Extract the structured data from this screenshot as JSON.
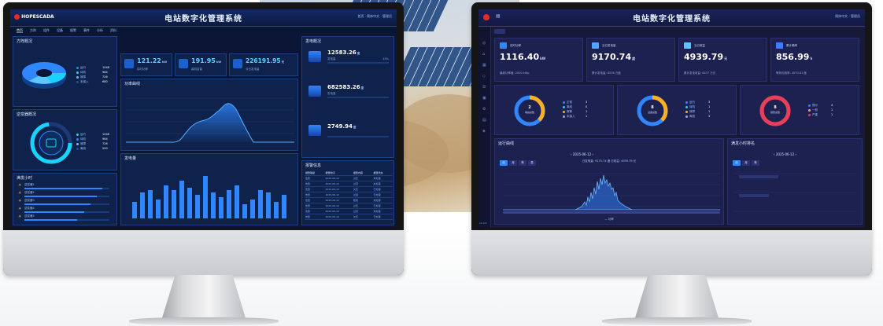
{
  "left_screen": {
    "logo": "HOPESCADA",
    "title": "电站数字化管理系统",
    "header_right": "首页 · 简体中文 · 管理员",
    "nav": [
      "首页",
      "方阵",
      "组件",
      "设备",
      "报警",
      "事件",
      "分析",
      "资料"
    ],
    "panels": {
      "matrix": "方阵概况",
      "inverter": "逆变器概况",
      "hours": "满发小时",
      "power_curve": "功率曲线",
      "energy": "发电量",
      "gen_overview": "发电概况",
      "alarms": "报警信息"
    },
    "kpis": [
      {
        "value": "121.22",
        "unit": "kW",
        "label": "实时功率"
      },
      {
        "value": "191.95",
        "unit": "kW",
        "label": "装机容量"
      },
      {
        "value": "226191.95",
        "unit": "元",
        "label": "今日发电量"
      }
    ],
    "gen_values": [
      {
        "value": "12583.26",
        "unit": "度",
        "label": "发电量",
        "pct": "45%"
      },
      {
        "value": "682583.26",
        "unit": "度",
        "label": "发电量"
      },
      {
        "value": "2749.94",
        "unit": "度",
        "label": ""
      }
    ],
    "matrix_legend": [
      {
        "name": "运行",
        "value": "1048"
      },
      {
        "name": "待机",
        "value": "964"
      },
      {
        "name": "故障",
        "value": "726"
      },
      {
        "name": "未接入",
        "value": "680"
      }
    ],
    "inverter_legend": [
      {
        "name": "运行",
        "value": "1048"
      },
      {
        "name": "待机",
        "value": "964"
      },
      {
        "name": "故障",
        "value": "726"
      },
      {
        "name": "离线",
        "value": "500"
      }
    ],
    "hours_items": [
      "逆变器1",
      "逆变器2",
      "逆变器3",
      "逆变器4",
      "逆变器5"
    ],
    "alarm_headers": [
      "报警等级",
      "报警时间",
      "报警内容",
      "报警状态"
    ],
    "alarm_rows": [
      [
        "告警",
        "2025-06-12",
        "过压",
        "未处理"
      ],
      [
        "告警",
        "2025-06-12",
        "过流",
        "未处理"
      ],
      [
        "告警",
        "2025-06-12",
        "欠压",
        "已处理"
      ],
      [
        "告警",
        "2025-06-12",
        "过温",
        "已处理"
      ],
      [
        "告警",
        "2025-06-12",
        "断线",
        "未处理"
      ],
      [
        "告警",
        "2025-06-12",
        "过压",
        "已处理"
      ],
      [
        "告警",
        "2025-06-12",
        "过流",
        "未处理"
      ],
      [
        "告警",
        "2025-06-12",
        "欠压",
        "已处理"
      ]
    ],
    "energy_bars": [
      0.35,
      0.55,
      0.6,
      0.4,
      0.7,
      0.6,
      0.8,
      0.65,
      0.5,
      0.9,
      0.55,
      0.45,
      0.6,
      0.7,
      0.3,
      0.4,
      0.6,
      0.55,
      0.35,
      0.5
    ]
  },
  "right_screen": {
    "title": "电站数字化管理系统",
    "header_right": "简体中文 · 管理员",
    "kpis": [
      {
        "label": "实时功率",
        "value": "1116.40",
        "unit": "kW",
        "sub": "最新功率值: 2000 kWp"
      },
      {
        "label": "当日发电量",
        "value": "9170.74",
        "unit": "度",
        "sub": "累计发电量: 8536 万度"
      },
      {
        "label": "当日收益",
        "value": "4939.79",
        "unit": "元",
        "sub": "累计发电收益: 8437 万元"
      },
      {
        "label": "累计确率",
        "value": "856.99",
        "unit": "h",
        "sub": "等效利用率: 4070.81 度"
      }
    ],
    "donuts": [
      {
        "center": "2",
        "label": "电站总数",
        "legend": [
          {
            "name": "正常",
            "value": "3"
          },
          {
            "name": "离线",
            "value": "0"
          },
          {
            "name": "报警",
            "value": "1"
          },
          {
            "name": "未接入",
            "value": "1"
          }
        ]
      },
      {
        "center": "8",
        "label": "设备总数",
        "legend": [
          {
            "name": "运行",
            "value": "3"
          },
          {
            "name": "待机",
            "value": "1"
          },
          {
            "name": "故障",
            "value": "1"
          },
          {
            "name": "离线",
            "value": "3"
          }
        ]
      },
      {
        "center": "8",
        "label": "报警总数",
        "legend": [
          {
            "name": "提示",
            "value": "4"
          },
          {
            "name": "一般",
            "value": "1"
          },
          {
            "name": "严重",
            "value": "1"
          }
        ]
      }
    ],
    "power_curve": {
      "title": "运行曲线",
      "tabs": [
        "日",
        "月",
        "年",
        "总"
      ],
      "date": "2025-06-12",
      "summary": "日发电量: 9170.74 度    日收益: 4939.79 元",
      "legend": "功率"
    },
    "hours_panel": {
      "title": "满发小时排名",
      "tabs": [
        "日",
        "月",
        "年"
      ],
      "date": "2025-06-12"
    },
    "version": "v1.0.0"
  },
  "colors": {
    "accent": "#2f86ff",
    "cyan": "#19d3ff",
    "orange": "#ffb020",
    "red": "#e84058",
    "logo": "#e32b2b"
  }
}
